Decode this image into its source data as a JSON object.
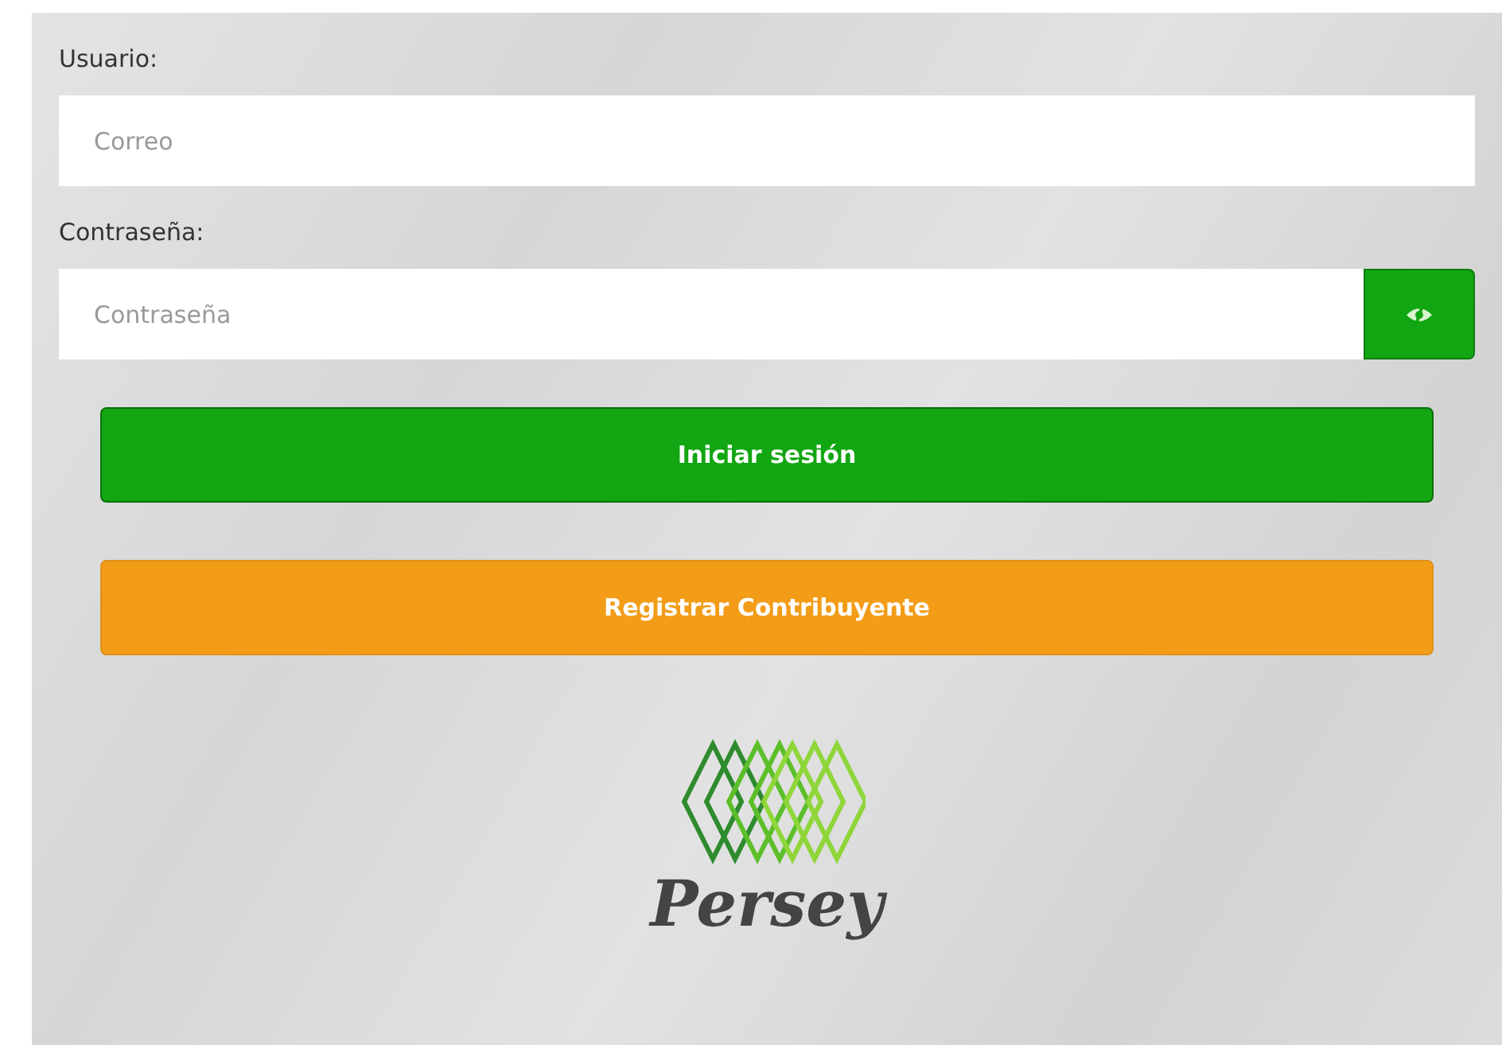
{
  "form": {
    "fields": [
      {
        "kind": "text",
        "label": "Usuario:",
        "placeholder": "Correo"
      },
      {
        "kind": "password",
        "label": "Contraseña:",
        "placeholder": "Contraseña"
      }
    ],
    "buttons": [
      {
        "kind": "primary",
        "label": "Iniciar sesión"
      },
      {
        "kind": "warning",
        "label": "Registrar Contribuyente"
      }
    ]
  },
  "logo": {
    "name": "Persey"
  }
}
